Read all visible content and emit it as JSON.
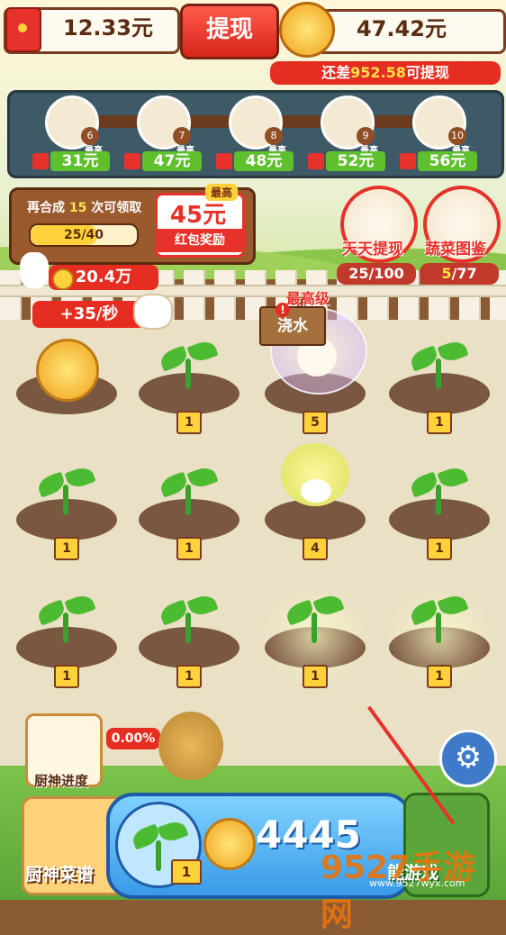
{
  "header": {
    "cash_amount": "12.33元",
    "withdraw_label": "提现",
    "coin_amount": "47.42元",
    "remaining_prefix": "还差",
    "remaining_value": "952.58",
    "remaining_suffix": "可提现"
  },
  "reward_track": {
    "items": [
      {
        "level": "6",
        "tag": "最高",
        "reward": "31元"
      },
      {
        "level": "7",
        "tag": "最高",
        "reward": "47元"
      },
      {
        "level": "8",
        "tag": "最高",
        "reward": "48元"
      },
      {
        "level": "9",
        "tag": "最高",
        "reward": "52元"
      },
      {
        "level": "10",
        "tag": "最高",
        "reward": "56元"
      }
    ]
  },
  "merge_panel": {
    "text_prefix": "再合成",
    "times": "15",
    "text_suffix": "次可领取",
    "progress": "25/40",
    "progress_fraction": 0.625,
    "max_tag": "最高",
    "redpack_value": "45元",
    "redpack_label": "红包奖励"
  },
  "side_buttons": {
    "daily_withdraw": {
      "label": "天天提现",
      "count": "25/100"
    },
    "veg_catalog": {
      "label": "蔬菜图鉴",
      "count_current": "5",
      "count_total": "/77"
    }
  },
  "income": {
    "coins": "20.4万",
    "rate": "+35/秒"
  },
  "field": {
    "max_level_label": "最高级",
    "water_label": "浇水",
    "plots": [
      {
        "type": "coin",
        "level": ""
      },
      {
        "type": "sprout",
        "level": "1"
      },
      {
        "type": "bubble",
        "level": "5"
      },
      {
        "type": "sprout",
        "level": "1"
      },
      {
        "type": "sprout",
        "level": "1"
      },
      {
        "type": "sprout",
        "level": "1"
      },
      {
        "type": "cabbage",
        "level": "4"
      },
      {
        "type": "sprout",
        "level": "1"
      },
      {
        "type": "sprout",
        "level": "1"
      },
      {
        "type": "sprout",
        "level": "1"
      },
      {
        "type": "sprout-glow",
        "level": "1"
      },
      {
        "type": "sprout-glow",
        "level": "1"
      }
    ]
  },
  "bottom": {
    "chef_progress_label": "厨神进度",
    "potato_percent": "0.00%",
    "chef_menu_label": "厨神菜谱",
    "buy_level": "1",
    "buy_price": "4445",
    "right_button_label": "能游戏"
  },
  "watermark": {
    "text": "9527手游网",
    "url": "www.9527wyx.com"
  },
  "colors": {
    "accent_red": "#e62d22",
    "gold": "#ffd23c",
    "blue": "#3a9ae8"
  }
}
